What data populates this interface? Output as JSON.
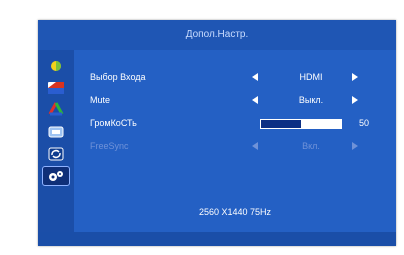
{
  "title": "Допол.Настр.",
  "sidebar": {
    "items": [
      {
        "icon": "brightness-icon"
      },
      {
        "icon": "picture-icon"
      },
      {
        "icon": "color-icon"
      },
      {
        "icon": "osd-settings-icon"
      },
      {
        "icon": "reset-icon"
      },
      {
        "icon": "extra-settings-icon",
        "active": true
      }
    ]
  },
  "settings": {
    "input": {
      "label": "Выбор Входа",
      "value": "HDMI"
    },
    "mute": {
      "label": "Mute",
      "value": "Выкл."
    },
    "volume": {
      "label": "ГромКоСТь",
      "value": "50",
      "level": 50
    },
    "freesync": {
      "label": "FreeSync",
      "value": "Вкл."
    }
  },
  "status": {
    "resolution": "2560 X1440  75Hz"
  },
  "colors": {
    "panel": "#2460c4",
    "title_bar": "#1f56b4",
    "accent_dark": "#0c2f84"
  }
}
